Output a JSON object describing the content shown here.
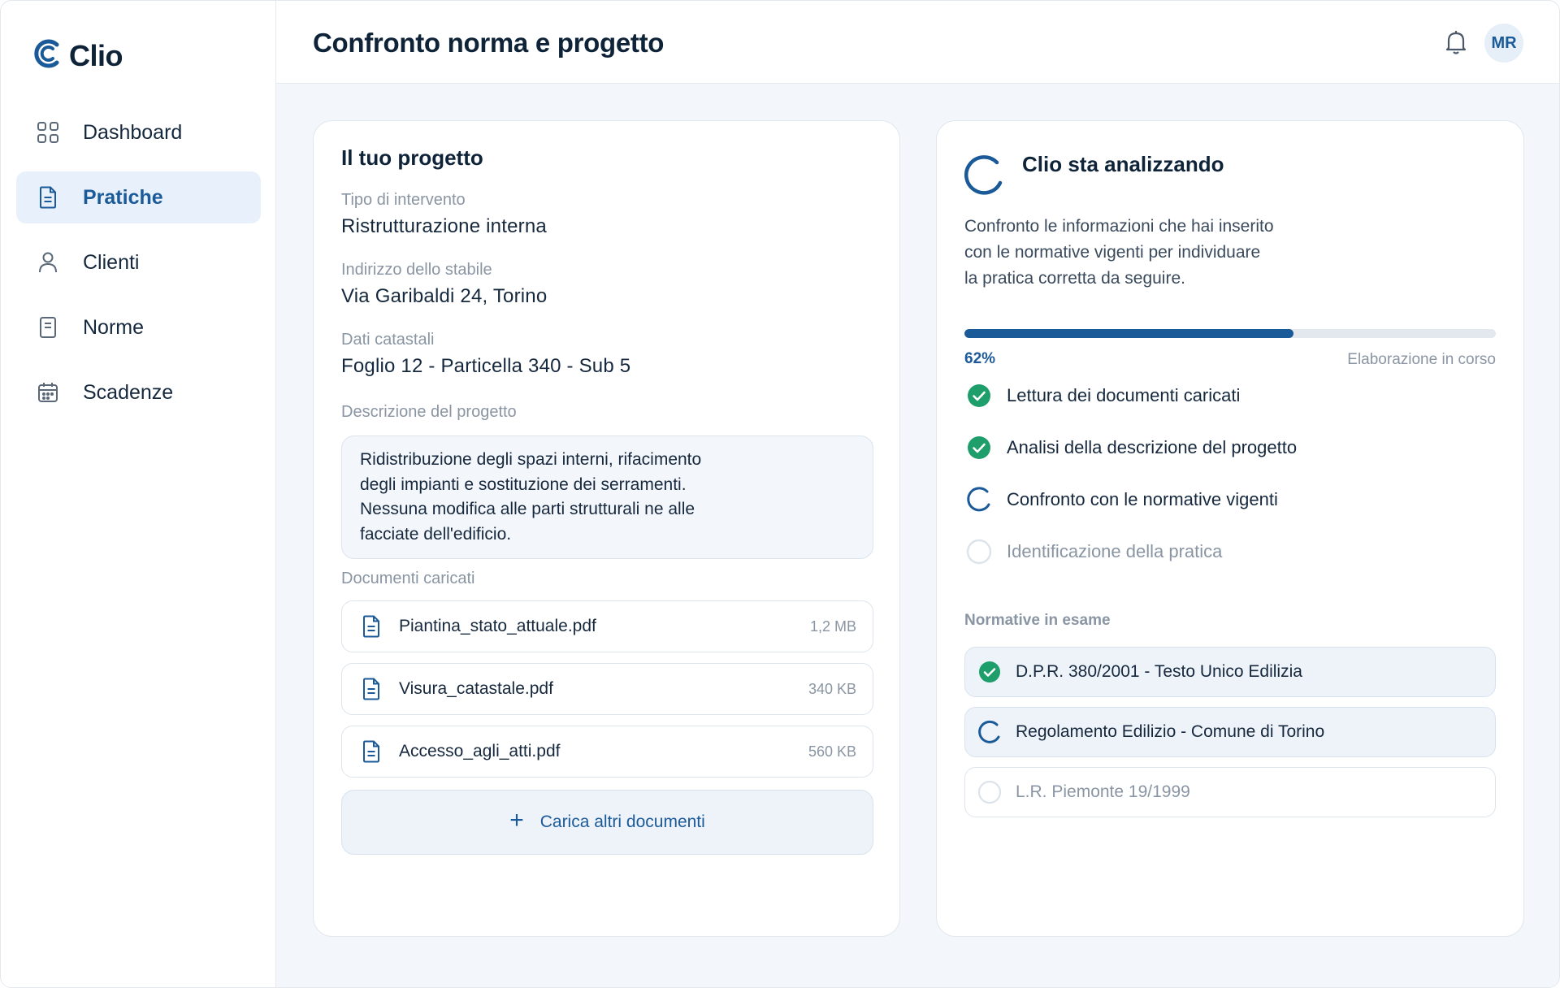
{
  "app": {
    "name": "Clio"
  },
  "sidebar": {
    "items": [
      {
        "label": "Dashboard",
        "icon": "grid-icon",
        "active": false
      },
      {
        "label": "Pratiche",
        "icon": "document-icon",
        "active": true
      },
      {
        "label": "Clienti",
        "icon": "user-icon",
        "active": false
      },
      {
        "label": "Norme",
        "icon": "book-icon",
        "active": false
      },
      {
        "label": "Scadenze",
        "icon": "calendar-icon",
        "active": false
      }
    ]
  },
  "header": {
    "title": "Confronto norma e progetto",
    "avatar_initials": "MR",
    "bell_icon": "bell-icon"
  },
  "project": {
    "title": "Il tuo progetto",
    "fields": [
      {
        "label": "Tipo di intervento",
        "value": "Ristrutturazione interna"
      },
      {
        "label": "Indirizzo dello stabile",
        "value": "Via Garibaldi 24, Torino"
      },
      {
        "label": "Dati catastali",
        "value": "Foglio 12 - Particella 340 - Sub 5"
      }
    ],
    "description_label": "Descrizione del progetto",
    "description_lines": [
      "Ridistribuzione degli spazi interni, rifacimento",
      "degli impianti e sostituzione dei serramenti.",
      "Nessuna modifica alle parti strutturali ne alle",
      "facciate dell'edificio."
    ],
    "documents_label": "Documenti caricati",
    "documents": [
      {
        "name": "Piantina_stato_attuale.pdf",
        "size": "1,2 MB"
      },
      {
        "name": "Visura_catastale.pdf",
        "size": "340 KB"
      },
      {
        "name": "Accesso_agli_atti.pdf",
        "size": "560 KB"
      }
    ],
    "upload_label": "Carica altri documenti"
  },
  "analysis": {
    "title": "Clio sta analizzando",
    "description_lines": [
      "Confronto le informazioni che hai inserito",
      "con le normative vigenti per individuare",
      "la pratica corretta da seguire."
    ],
    "progress": 0.62,
    "progress_label": "62%",
    "progress_status": "Elaborazione in corso",
    "steps": [
      {
        "label": "Lettura dei documenti caricati",
        "status": "done"
      },
      {
        "label": "Analisi della descrizione del progetto",
        "status": "done"
      },
      {
        "label": "Confronto con le normative vigenti",
        "status": "active"
      },
      {
        "label": "Identificazione della pratica",
        "status": "pending"
      }
    ],
    "norms_label": "Normative in esame",
    "norms": [
      {
        "label": "D.P.R. 380/2001 - Testo Unico Edilizia",
        "status": "done"
      },
      {
        "label": "Regolamento Edilizio - Comune di Torino",
        "status": "active"
      },
      {
        "label": "L.R. Piemonte 19/1999",
        "status": "pending"
      }
    ]
  },
  "colors": {
    "accent": "#1b5a98",
    "success": "#1e9e6a",
    "background": "#f3f6fa"
  }
}
